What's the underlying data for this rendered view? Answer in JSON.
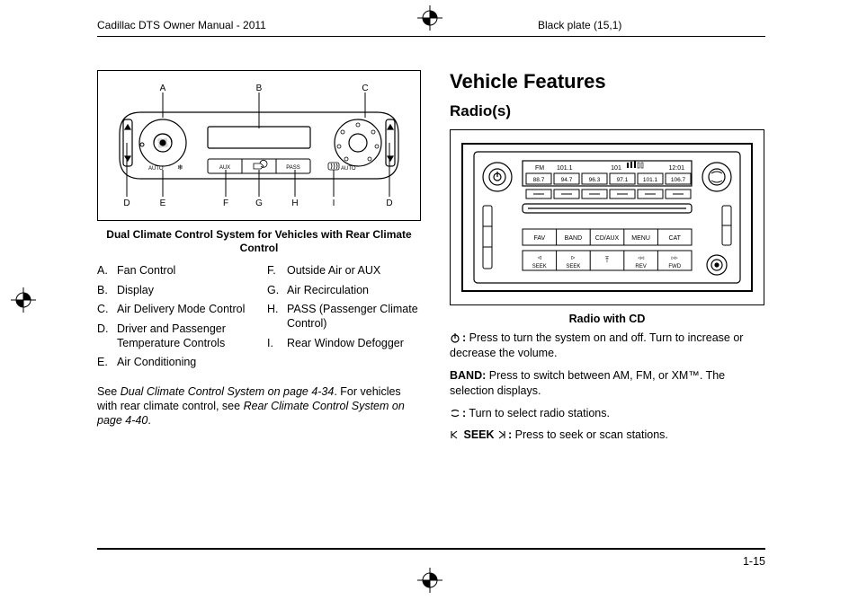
{
  "header": {
    "left": "Cadillac DTS Owner Manual - 2011",
    "right": "Black plate (15,1)"
  },
  "climate": {
    "caption": "Dual Climate Control System for Vehicles with Rear Climate Control",
    "labels": {
      "A": "A",
      "B": "B",
      "C": "C",
      "D": "D",
      "E": "E",
      "F": "F",
      "G": "G",
      "H": "H",
      "I": "I"
    },
    "panel": {
      "auto": "AUTO",
      "aux": "AUX",
      "pass": "PASS"
    },
    "legend_left": [
      {
        "k": "A.",
        "v": "Fan Control"
      },
      {
        "k": "B.",
        "v": "Display"
      },
      {
        "k": "C.",
        "v": "Air Delivery Mode Control"
      },
      {
        "k": "D.",
        "v": "Driver and Passenger Temperature Controls"
      },
      {
        "k": "E.",
        "v": "Air Conditioning"
      }
    ],
    "legend_right": [
      {
        "k": "F.",
        "v": "Outside Air or AUX"
      },
      {
        "k": "G.",
        "v": "Air Recirculation"
      },
      {
        "k": "H.",
        "v": "PASS (Passenger Climate Control)"
      },
      {
        "k": "I.",
        "v": "Rear Window Defogger"
      }
    ],
    "para_pre": "See ",
    "para_em1": "Dual Climate Control System on page 4‑34",
    "para_mid": ". For vehicles with rear climate control, see ",
    "para_em2": "Rear Climate Control System on page 4‑40",
    "para_post": "."
  },
  "vehicle": {
    "title": "Vehicle Features",
    "radios": "Radio(s)",
    "caption": "Radio with CD",
    "panel": {
      "fm": "FM",
      "freq": "101.1",
      "psig": "101",
      "time": "12:01",
      "presets": [
        "88.7",
        "94.7",
        "96.3",
        "97.1",
        "101.1",
        "106.7"
      ],
      "buttons": [
        "FAV",
        "BAND",
        "CD/AUX",
        "MENU",
        "CAT"
      ],
      "seek1": "SEEK",
      "seek2": "SEEK",
      "info": "REV",
      "fwd": "FWD"
    },
    "power_text": " Press to turn the system on and off. Turn to increase or decrease the volume.",
    "band_label": "BAND:",
    "band_text": " Press to switch between AM, FM, or XM™. The selection displays.",
    "tune_text": " Turn to select radio stations.",
    "seek_label": "SEEK",
    "seek_text": " Press to seek or scan stations."
  },
  "page_number": "1-15"
}
